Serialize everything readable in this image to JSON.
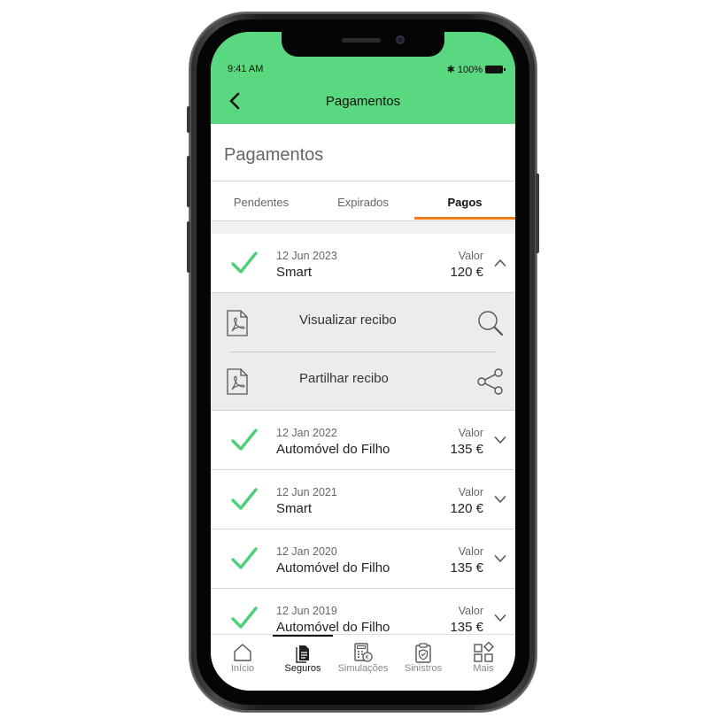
{
  "status_bar": {
    "time": "9:41 AM",
    "bluetooth": "✱",
    "battery": "100%"
  },
  "nav": {
    "title": "Pagamentos",
    "back_icon": "chevron-left-icon"
  },
  "page": {
    "title": "Pagamentos"
  },
  "tabs": [
    {
      "label": "Pendentes",
      "active": false
    },
    {
      "label": "Expirados",
      "active": false
    },
    {
      "label": "Pagos",
      "active": true
    }
  ],
  "payments": [
    {
      "date": "12 Jun 2023",
      "name": "Smart",
      "value_label": "Valor",
      "value": "120 €",
      "expanded": true
    },
    {
      "date": "12 Jan 2022",
      "name": "Automóvel do Filho",
      "value_label": "Valor",
      "value": "135 €",
      "expanded": false
    },
    {
      "date": "12 Jun 2021",
      "name": "Smart",
      "value_label": "Valor",
      "value": "120 €",
      "expanded": false
    },
    {
      "date": "12 Jan 2020",
      "name": "Automóvel do Filho",
      "value_label": "Valor",
      "value": "135 €",
      "expanded": false
    },
    {
      "date": "12 Jun 2019",
      "name": "Automóvel do Filho",
      "value_label": "Valor",
      "value": "135 €",
      "expanded": false
    }
  ],
  "receipt_actions": [
    {
      "label": "Visualizar recibo",
      "icon": "magnifier-icon"
    },
    {
      "label": "Partilhar recibo",
      "icon": "share-icon"
    }
  ],
  "bottom_nav": [
    {
      "label": "Início",
      "icon": "home-icon",
      "active": false
    },
    {
      "label": "Seguros",
      "icon": "documents-icon",
      "active": true
    },
    {
      "label": "Simulações",
      "icon": "calculator-icon",
      "active": false
    },
    {
      "label": "Sinistros",
      "icon": "clipboard-shield-icon",
      "active": false
    },
    {
      "label": "Mais",
      "icon": "grid-icon",
      "active": false
    }
  ],
  "colors": {
    "header": "#5ad87f",
    "accent": "#f07a18",
    "check": "#4cd07a"
  }
}
